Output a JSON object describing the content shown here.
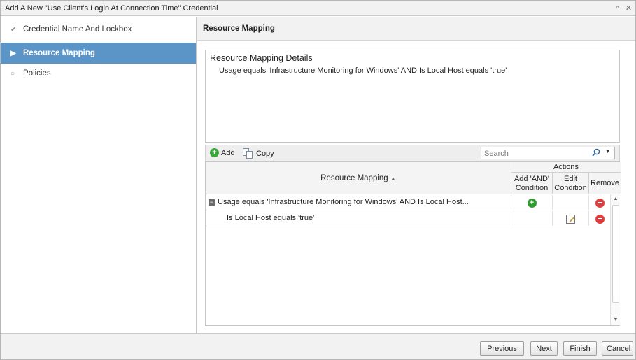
{
  "window": {
    "title": "Add A New \"Use Client's Login At Connection Time\" Credential",
    "restore_icon": "restore-icon",
    "close_icon": "close-icon"
  },
  "nav": {
    "items": [
      {
        "label": "Credential Name And Lockbox",
        "icon": "checkmark-icon",
        "glyph": "✔"
      },
      {
        "label": "Resource Mapping",
        "icon": "arrow-right-icon",
        "glyph": "▶",
        "active": true
      },
      {
        "label": "Policies",
        "icon": "circle-bullet-icon",
        "glyph": "○"
      }
    ]
  },
  "main": {
    "section_title": "Resource Mapping",
    "details": {
      "title": "Resource Mapping Details",
      "text": "Usage equals 'Infrastructure Monitoring for Windows' AND Is Local Host equals 'true'"
    },
    "toolbar": {
      "add_label": "Add",
      "copy_label": "Copy",
      "search_placeholder": "Search"
    },
    "grid": {
      "columns": {
        "main": "Resource Mapping",
        "sort_glyph": "▲",
        "actions_group": "Actions",
        "add_and_line1": "Add 'AND'",
        "add_and_line2": "Condition",
        "edit_line1": "Edit",
        "edit_line2": "Condition",
        "remove": "Remove"
      },
      "rows": [
        {
          "text": "Usage equals 'Infrastructure Monitoring for Windows' AND Is Local Host...",
          "collapsible": true,
          "has_add": true,
          "has_edit": false,
          "has_remove": true
        },
        {
          "text": "Is Local Host equals 'true'",
          "collapsible": false,
          "has_add": false,
          "has_edit": true,
          "has_remove": true
        }
      ]
    }
  },
  "footer": {
    "previous": "Previous",
    "next": "Next",
    "finish": "Finish",
    "cancel": "Cancel"
  },
  "colors": {
    "active_nav": "#5b95c8",
    "add_green": "#2f9a2f",
    "remove_red": "#e23b3b"
  }
}
